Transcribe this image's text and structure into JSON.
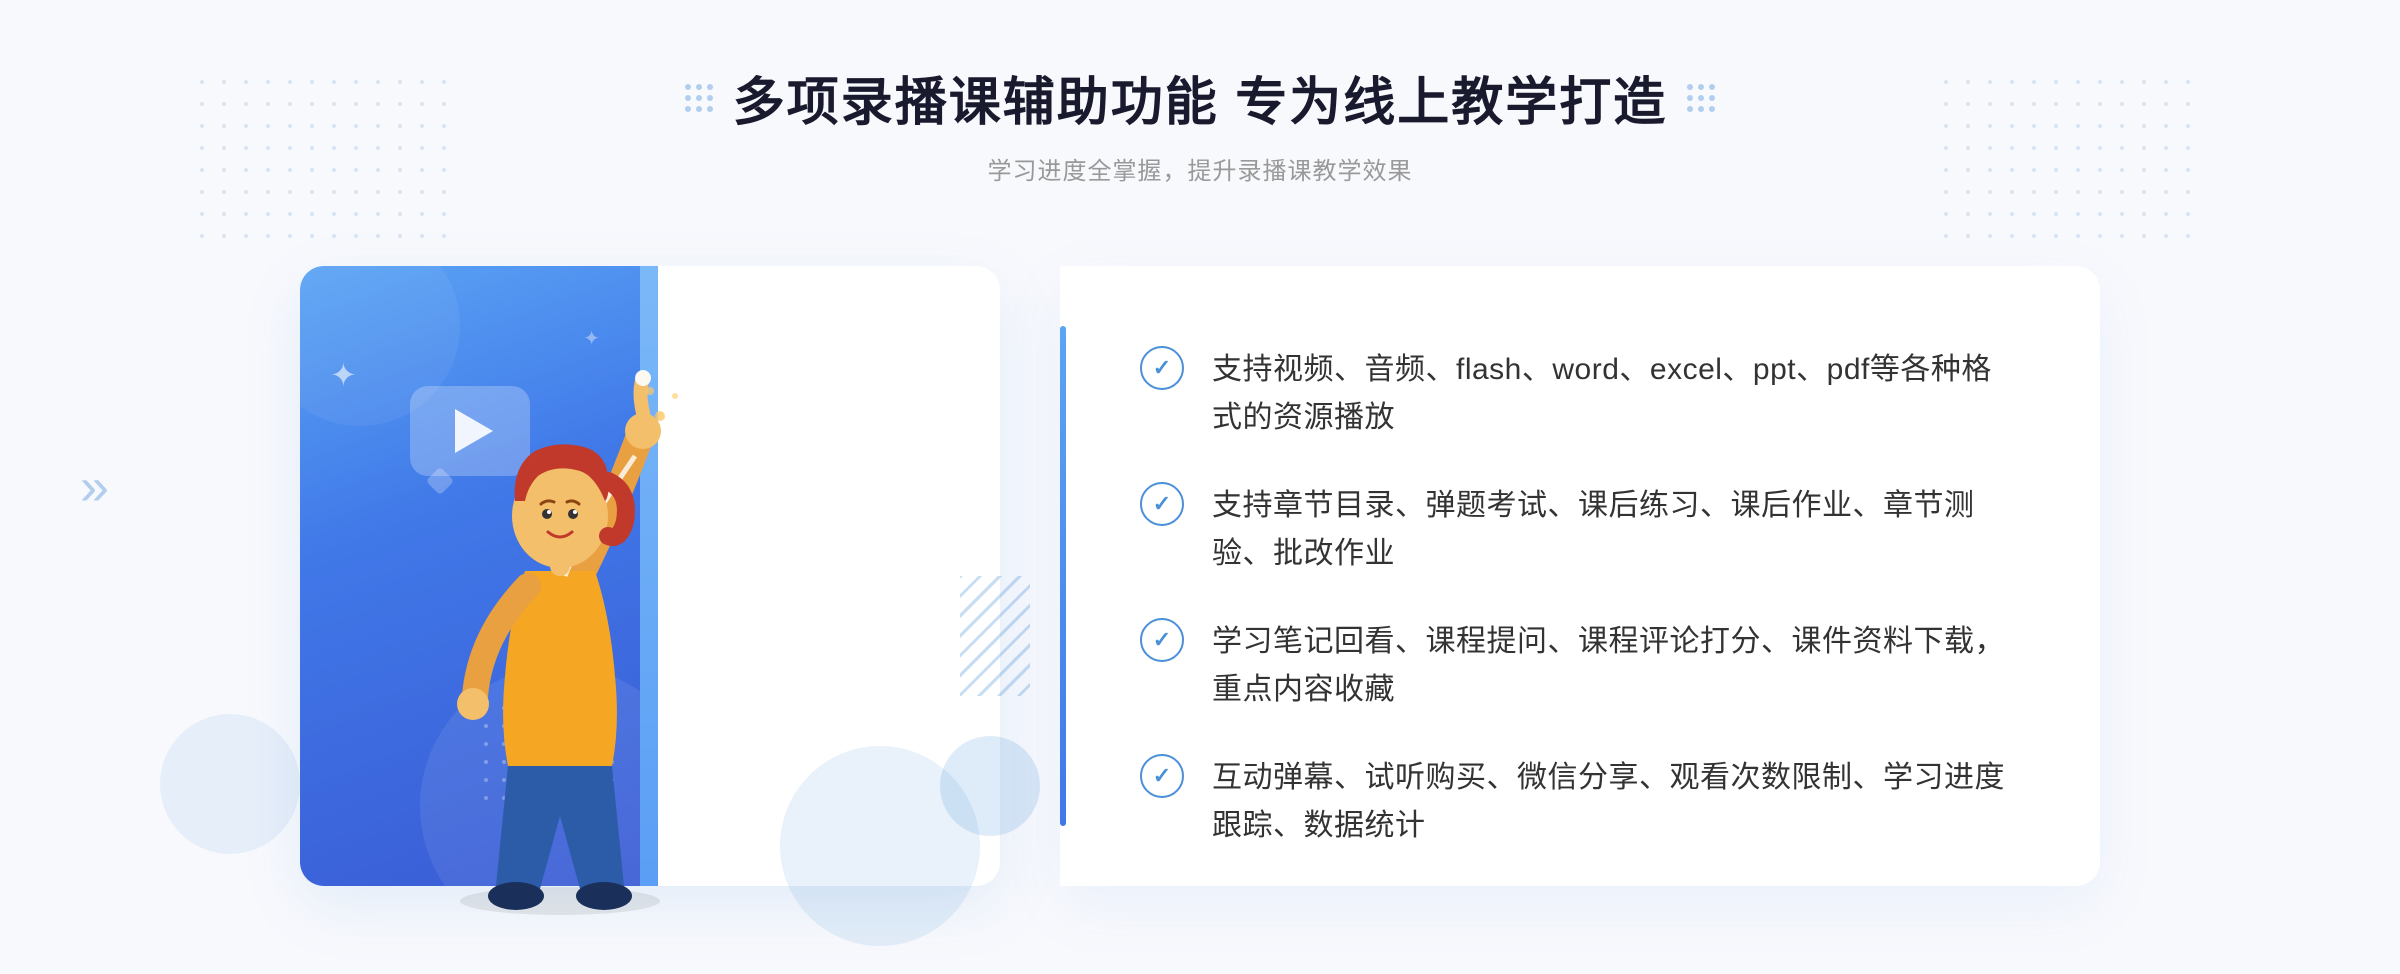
{
  "page": {
    "background": "#f5f7fc"
  },
  "header": {
    "main_title": "多项录播课辅助功能 专为线上教学打造",
    "sub_title": "学习进度全掌握，提升录播课教学效果"
  },
  "features": [
    {
      "id": 1,
      "text": "支持视频、音频、flash、word、excel、ppt、pdf等各种格式的资源播放"
    },
    {
      "id": 2,
      "text": "支持章节目录、弹题考试、课后练习、课后作业、章节测验、批改作业"
    },
    {
      "id": 3,
      "text": "学习笔记回看、课程提问、课程评论打分、课件资料下载，重点内容收藏"
    },
    {
      "id": 4,
      "text": "互动弹幕、试听购买、微信分享、观看次数限制、学习进度跟踪、数据统计"
    }
  ],
  "decorations": {
    "chevron_symbol": "»",
    "play_icon": "▶"
  }
}
